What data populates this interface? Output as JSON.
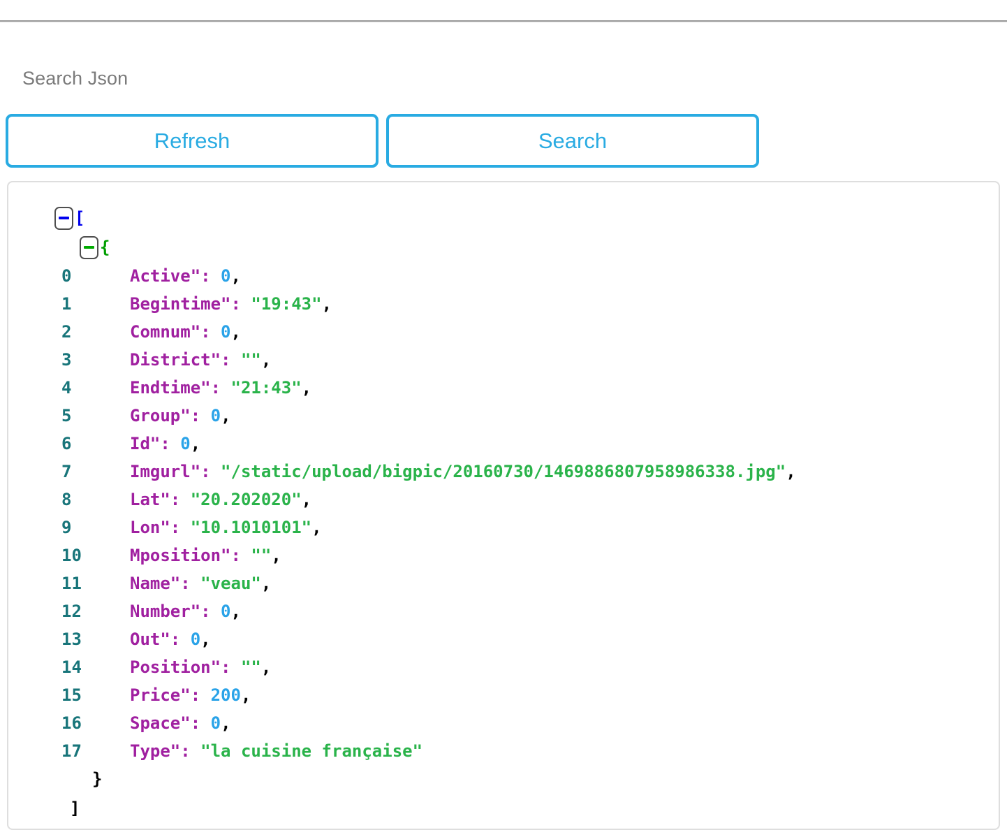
{
  "page": {
    "heading": "Search Json"
  },
  "toolbar": {
    "refresh_label": "Refresh",
    "search_label": "Search"
  },
  "colors": {
    "button_accent": "#29abe2",
    "heading": "#7b7b7b",
    "line_number": "#18757a",
    "key": "#a020a0",
    "string_value": "#2ab34a",
    "number_value": "#2aa3e8",
    "bracket_array": "#0000ee",
    "bracket_object": "#009e00",
    "panel_border": "#dedede",
    "top_rule": "#9a9a9a"
  },
  "json_viewer": {
    "array_open": "[",
    "object_open": "{",
    "object_close": "}",
    "array_close": "]",
    "toggle_array": "collapse-array-toggle",
    "toggle_object": "collapse-object-toggle",
    "rows": [
      {
        "index": "0",
        "key": "Active\":",
        "value": "0",
        "value_type": "num",
        "comma": ","
      },
      {
        "index": "1",
        "key": "Begintime\":",
        "value": "\"19:43\"",
        "value_type": "str",
        "comma": ","
      },
      {
        "index": "2",
        "key": "Comnum\":",
        "value": "0",
        "value_type": "num",
        "comma": ","
      },
      {
        "index": "3",
        "key": "District\":",
        "value": "\"\"",
        "value_type": "str",
        "comma": ","
      },
      {
        "index": "4",
        "key": "Endtime\":",
        "value": "\"21:43\"",
        "value_type": "str",
        "comma": ","
      },
      {
        "index": "5",
        "key": "Group\":",
        "value": "0",
        "value_type": "num",
        "comma": ","
      },
      {
        "index": "6",
        "key": "Id\":",
        "value": "0",
        "value_type": "num",
        "comma": ","
      },
      {
        "index": "7",
        "key": "Imgurl\":",
        "value": "\"/static/upload/bigpic/20160730/1469886807958986338.jpg\"",
        "value_type": "str",
        "comma": ","
      },
      {
        "index": "8",
        "key": "Lat\":",
        "value": "\"20.202020\"",
        "value_type": "str",
        "comma": ","
      },
      {
        "index": "9",
        "key": "Lon\":",
        "value": "\"10.1010101\"",
        "value_type": "str",
        "comma": ","
      },
      {
        "index": "10",
        "key": "Mposition\":",
        "value": "\"\"",
        "value_type": "str",
        "comma": ","
      },
      {
        "index": "11",
        "key": "Name\":",
        "value": "\"veau\"",
        "value_type": "str",
        "comma": ","
      },
      {
        "index": "12",
        "key": "Number\":",
        "value": "0",
        "value_type": "num",
        "comma": ","
      },
      {
        "index": "13",
        "key": "Out\":",
        "value": "0",
        "value_type": "num",
        "comma": ","
      },
      {
        "index": "14",
        "key": "Position\":",
        "value": "\"\"",
        "value_type": "str",
        "comma": ","
      },
      {
        "index": "15",
        "key": "Price\":",
        "value": "200",
        "value_type": "num",
        "comma": ","
      },
      {
        "index": "16",
        "key": "Space\":",
        "value": "0",
        "value_type": "num",
        "comma": ","
      },
      {
        "index": "17",
        "key": "Type\":",
        "value": "\"la cuisine française\"",
        "value_type": "str",
        "comma": ""
      }
    ]
  }
}
